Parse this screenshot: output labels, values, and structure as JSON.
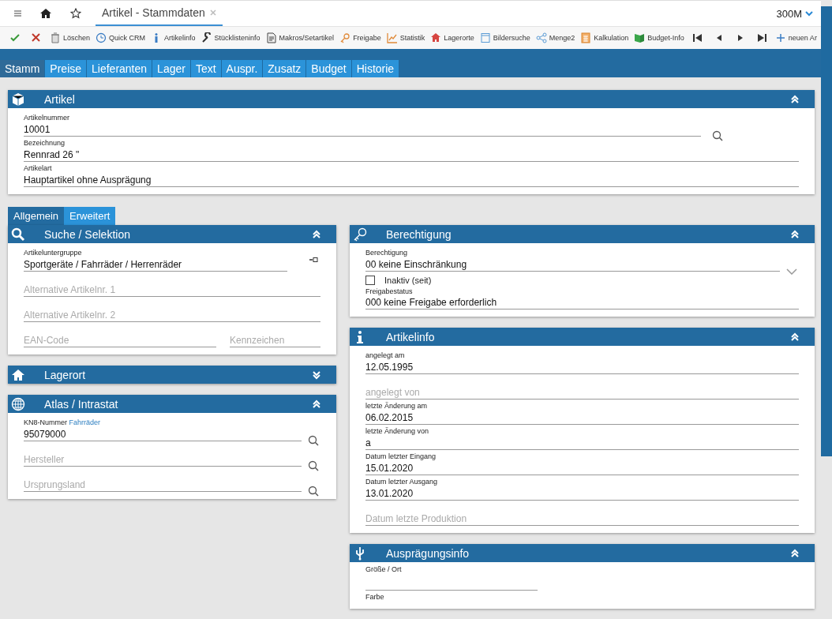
{
  "topbar": {
    "tab_title": "Artikel - Stammdaten",
    "company": "300M"
  },
  "toolbar": [
    {
      "kind": "icon"
    },
    {
      "kind": "icon"
    },
    {
      "kind": "labeled",
      "label": "Löschen"
    },
    {
      "kind": "labeled",
      "label": "Quick CRM"
    },
    {
      "kind": "labeled",
      "label": "Artikelinfo"
    },
    {
      "kind": "labeled",
      "label": "Stücklisteninfo"
    },
    {
      "kind": "labeled",
      "label": "Makros/Setartikel"
    },
    {
      "kind": "labeled",
      "label": "Freigabe"
    },
    {
      "kind": "labeled",
      "label": "Statistik"
    },
    {
      "kind": "labeled",
      "label": "Lagerorte"
    },
    {
      "kind": "labeled",
      "label": "Bildersuche"
    },
    {
      "kind": "labeled",
      "label": "Menge2"
    },
    {
      "kind": "labeled",
      "label": "Kalkulation"
    },
    {
      "kind": "labeled",
      "label": "Budget-Info"
    },
    {
      "kind": "icon"
    },
    {
      "kind": "icon"
    },
    {
      "kind": "icon"
    },
    {
      "kind": "icon"
    },
    {
      "kind": "labeled",
      "label": "neuen Ar"
    }
  ],
  "main_tabs": [
    {
      "label": "Stamm",
      "selected": true
    },
    {
      "label": "Preise",
      "selected": false
    },
    {
      "label": "Lieferanten",
      "selected": false
    },
    {
      "label": "Lager",
      "selected": false
    },
    {
      "label": "Text",
      "selected": false
    },
    {
      "label": "Auspr.",
      "selected": false
    },
    {
      "label": "Zusatz",
      "selected": false
    },
    {
      "label": "Budget",
      "selected": false
    },
    {
      "label": "Historie",
      "selected": false
    }
  ],
  "artikel_panel": {
    "title": "Artikel",
    "expanded": true,
    "fields": [
      {
        "kind": "search",
        "label": "Artikelnummer",
        "value": "10001"
      },
      {
        "kind": "text",
        "label": "Bezeichnung",
        "value": "Rennrad 26 \""
      },
      {
        "kind": "text",
        "label": "Artikelart",
        "value": "Hauptartikel ohne Ausprägung"
      }
    ]
  },
  "sub_tabs": [
    {
      "label": "Allgemein",
      "selected": true
    },
    {
      "label": "Erweitert",
      "selected": false
    }
  ],
  "left_panels": [
    {
      "title": "Suche / Selektion",
      "expanded": true,
      "fields": [
        {
          "kind": "link",
          "label": "Artikeluntergruppe",
          "value": "Sportgeräte / Fahrräder / Herrenräder"
        },
        {
          "kind": "text",
          "placeholder": "Alternative Artikelnr. 1"
        },
        {
          "kind": "text",
          "placeholder": "Alternative Artikelnr. 2"
        },
        {
          "kind": "pair",
          "fields": [
            {
              "kind": "text",
              "placeholder": "EAN-Code"
            },
            {
              "kind": "text",
              "placeholder": "Kennzeichen"
            }
          ]
        }
      ]
    },
    {
      "title": "Lagerort",
      "expanded": false
    },
    {
      "title": "Atlas / Intrastat",
      "expanded": true,
      "fields": [
        {
          "kind": "search",
          "label": "KN8-Nummer",
          "label_link": "Fahrräder",
          "value": "95079000"
        },
        {
          "kind": "search",
          "placeholder": "Hersteller"
        },
        {
          "kind": "search",
          "placeholder": "Ursprungsland"
        }
      ]
    }
  ],
  "right_panels": [
    {
      "title": "Berechtigung",
      "expanded": true,
      "fields": [
        {
          "kind": "select",
          "label": "Berechtigung",
          "value": "00 keine Einschränkung"
        },
        {
          "kind": "checkbox",
          "label": "Inaktiv (seit)",
          "checked": false
        },
        {
          "kind": "text",
          "label": "Freigabestatus",
          "value": "000 keine Freigabe erforderlich"
        }
      ]
    },
    {
      "title": "Artikelinfo",
      "expanded": true,
      "fields": [
        {
          "kind": "text",
          "label": "angelegt am",
          "value": "12.05.1995"
        },
        {
          "kind": "text",
          "placeholder": "angelegt von"
        },
        {
          "kind": "text",
          "label": "letzte Änderung am",
          "value": "06.02.2015"
        },
        {
          "kind": "text",
          "label": "letzte Änderung von",
          "value": "a"
        },
        {
          "kind": "text",
          "label": "Datum letzter Eingang",
          "value": "15.01.2020"
        },
        {
          "kind": "text",
          "label": "Datum letzter Ausgang",
          "value": "13.01.2020"
        },
        {
          "kind": "text",
          "placeholder": "Datum letzte Produktion"
        }
      ]
    },
    {
      "title": "Ausprägungsinfo",
      "expanded": true,
      "fields": [
        {
          "kind": "short",
          "label": "Größe / Ort"
        },
        {
          "kind": "caption",
          "label": "Farbe"
        }
      ]
    }
  ]
}
